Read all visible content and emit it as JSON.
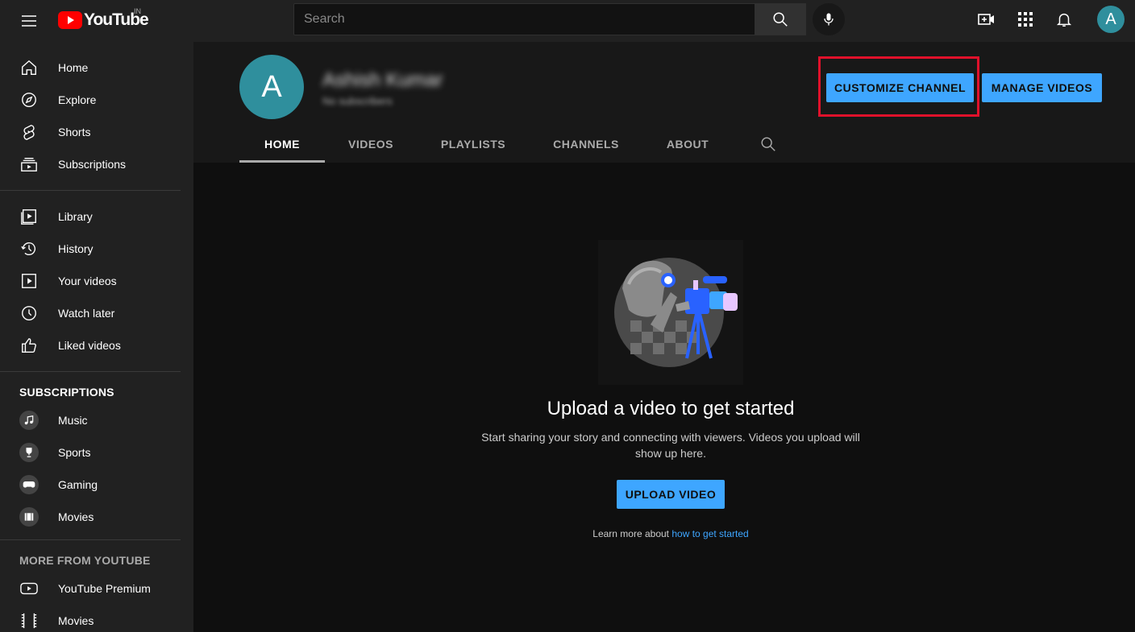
{
  "header": {
    "logo_text": "YouTube",
    "country_code": "IN",
    "search_placeholder": "Search",
    "account_initial": "A"
  },
  "sidebar": {
    "main": [
      {
        "label": "Home",
        "icon": "home-icon"
      },
      {
        "label": "Explore",
        "icon": "explore-icon"
      },
      {
        "label": "Shorts",
        "icon": "shorts-icon"
      },
      {
        "label": "Subscriptions",
        "icon": "subscriptions-icon"
      }
    ],
    "library": [
      {
        "label": "Library",
        "icon": "library-icon"
      },
      {
        "label": "History",
        "icon": "history-icon"
      },
      {
        "label": "Your videos",
        "icon": "your-videos-icon"
      },
      {
        "label": "Watch later",
        "icon": "watch-later-icon"
      },
      {
        "label": "Liked videos",
        "icon": "liked-videos-icon"
      }
    ],
    "subscriptions_heading": "SUBSCRIPTIONS",
    "subscriptions": [
      {
        "label": "Music",
        "icon": "music-icon"
      },
      {
        "label": "Sports",
        "icon": "trophy-icon"
      },
      {
        "label": "Gaming",
        "icon": "gaming-icon"
      },
      {
        "label": "Movies",
        "icon": "movies-icon"
      }
    ],
    "more_heading": "MORE FROM YOUTUBE",
    "more": [
      {
        "label": "YouTube Premium",
        "icon": "youtube-premium-icon"
      },
      {
        "label": "Movies",
        "icon": "film-strip-icon"
      }
    ]
  },
  "channel": {
    "avatar_initial": "A",
    "name": "Ashish Kumar",
    "subscribers": "No subscribers",
    "customize_label": "CUSTOMIZE CHANNEL",
    "manage_label": "MANAGE VIDEOS",
    "tabs": [
      "HOME",
      "VIDEOS",
      "PLAYLISTS",
      "CHANNELS",
      "ABOUT"
    ],
    "active_tab": "HOME"
  },
  "empty_state": {
    "title": "Upload a video to get started",
    "description": "Start sharing your story and connecting with viewers. Videos you upload will show up here.",
    "upload_label": "UPLOAD VIDEO",
    "learn_prefix": "Learn more about",
    "learn_link": "how to get started"
  },
  "colors": {
    "accent": "#3ea6ff",
    "highlight": "#e0112b",
    "avatar": "#2f8f9d",
    "logo_red": "#ff0000"
  }
}
